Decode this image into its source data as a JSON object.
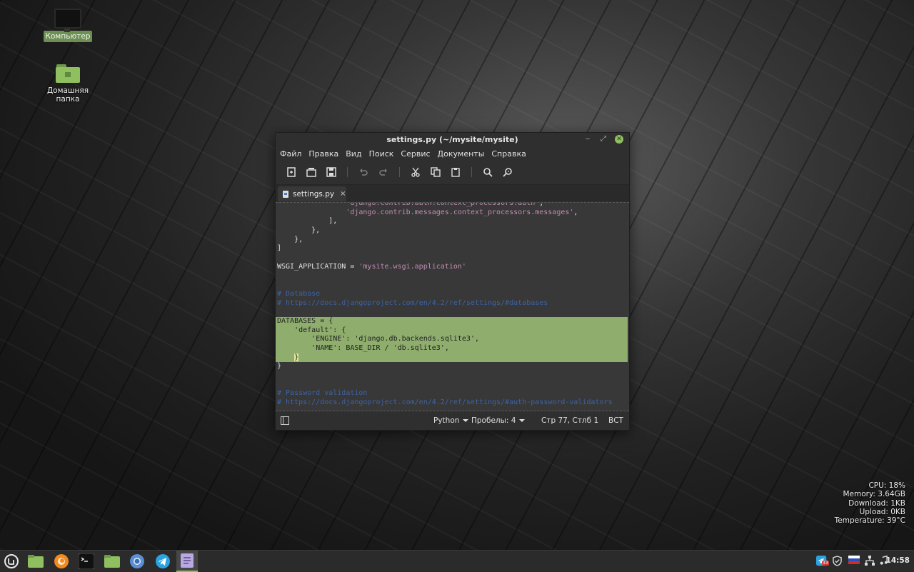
{
  "desktop": {
    "icons": [
      {
        "label": "Компьютер",
        "icon": "computer-icon"
      },
      {
        "label": "Домашняя папка",
        "icon": "home-folder-icon"
      }
    ]
  },
  "window": {
    "title": "settings.py (~/mysite/mysite)",
    "minimize_glyph": "‒",
    "maximize_glyph": "⤢",
    "close_glyph": "✕",
    "menu": [
      "Файл",
      "Правка",
      "Вид",
      "Поиск",
      "Сервис",
      "Документы",
      "Справка"
    ],
    "toolbar": [
      "new-document-icon",
      "new-window-icon",
      "save-icon",
      "undo-icon",
      "redo-icon",
      "cut-icon",
      "copy-icon",
      "paste-icon",
      "search-icon",
      "search-replace-icon"
    ],
    "tab": {
      "label": "settings.py",
      "close": "×"
    },
    "code_lines": [
      "                'django.contrib.auth.context_processors.auth',",
      "                'django.contrib.messages.context_processors.messages',",
      "            ],",
      "        },",
      "    },",
      "]",
      "",
      "WSGI_APPLICATION = 'mysite.wsgi.application'",
      "",
      "",
      "# Database",
      "# https://docs.djangoproject.com/en/4.2/ref/settings/#databases",
      "",
      "DATABASES = {",
      "    'default': {",
      "        'ENGINE': 'django.db.backends.sqlite3',",
      "        'NAME': BASE_DIR / 'db.sqlite3',",
      "    }",
      "}",
      "",
      "",
      "# Password validation",
      "# https://docs.djangoproject.com/en/4.2/ref/settings/#auth-password-validators"
    ],
    "status": {
      "language": "Python",
      "indent": "Пробелы: 4",
      "position": "Стр 77, Стлб 1",
      "mode": "ВСТ"
    }
  },
  "sysmon": {
    "cpu": "CPU: 18%",
    "memory": "Memory: 3.64GB",
    "download": "Download: 1KB",
    "upload": "Upload: 0KB",
    "temperature": "Temperature: 39°C"
  },
  "taskbar": {
    "apps": [
      "mint-menu-icon",
      "files-icon",
      "firefox-icon",
      "terminal-icon",
      "folder-icon",
      "chromium-icon",
      "telegram-icon",
      "text-editor-icon"
    ],
    "tray": [
      "telegram-tray-icon",
      "shield-icon",
      "keyboard-layout-icon",
      "network-icon",
      "sound-icon"
    ],
    "telegram_badge": "33",
    "clock": "14:58"
  },
  "colors": {
    "accent": "#8fbf5f",
    "selection": "#8fae6e",
    "string": "#c28bb4",
    "comment": "#3b63a8"
  }
}
